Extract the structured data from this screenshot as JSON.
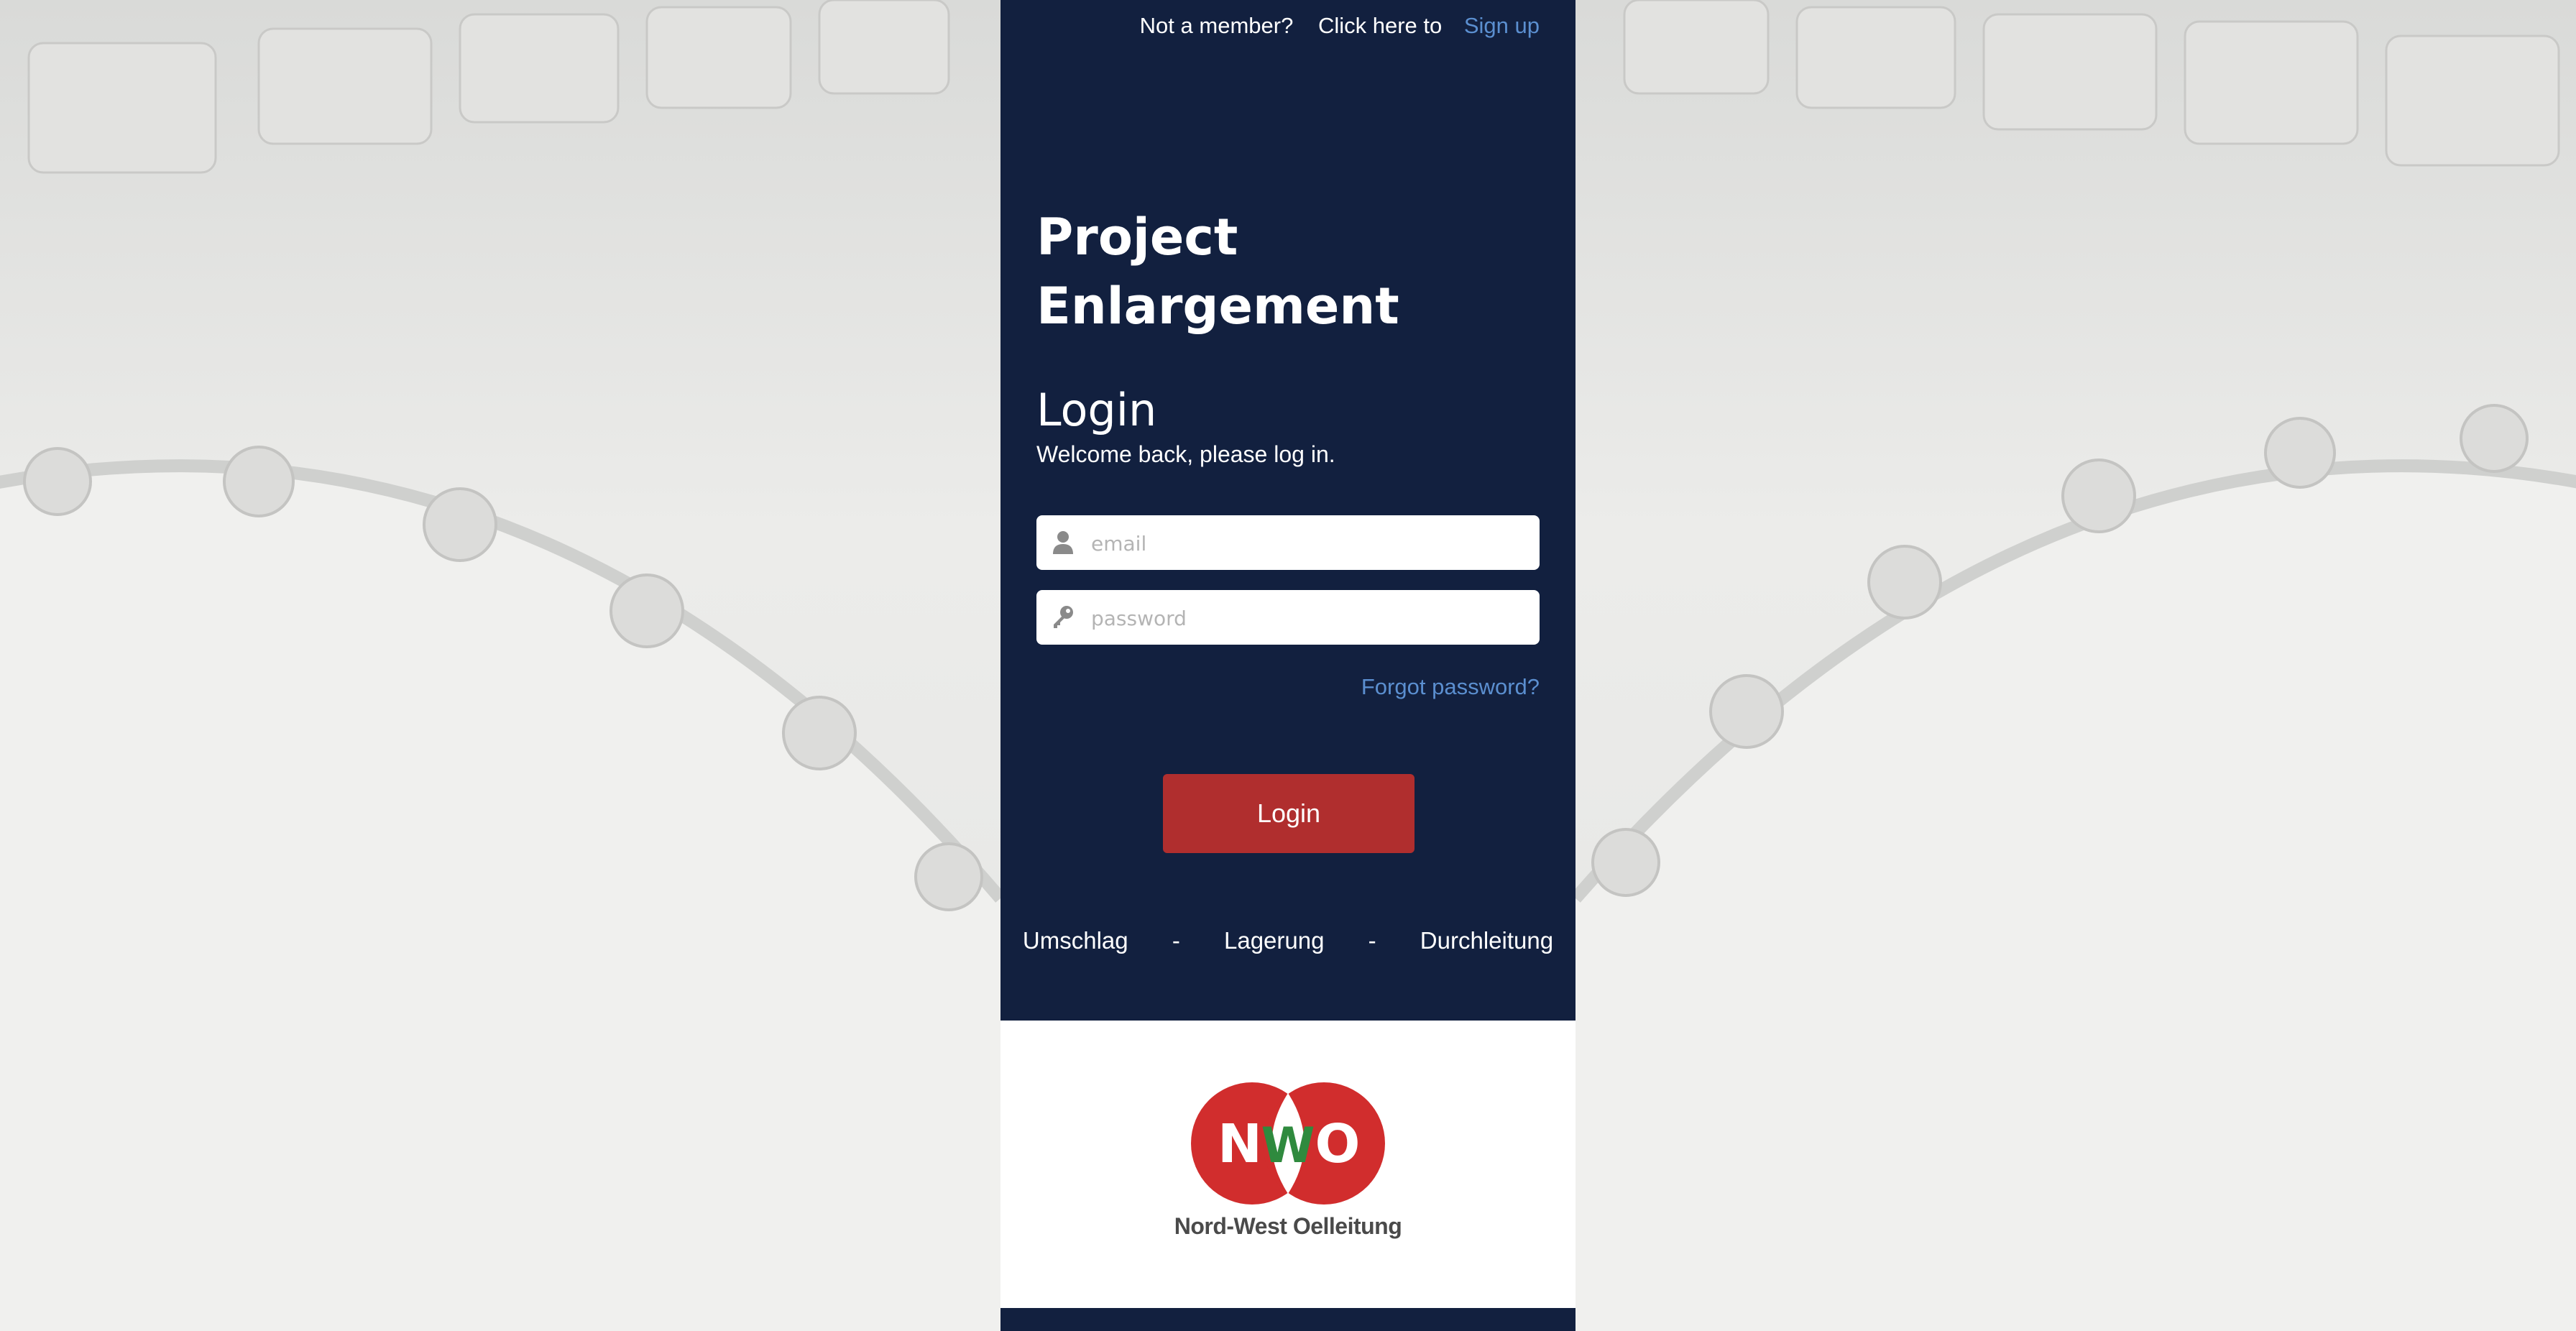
{
  "topbar": {
    "not_member": "Not a member?",
    "click_here": "Click here to",
    "signup": "Sign up"
  },
  "project_title": "Project Enlargement",
  "login": {
    "heading": "Login",
    "welcome": "Welcome back, please log in.",
    "email_placeholder": "email",
    "password_placeholder": "password",
    "forgot": "Forgot password?",
    "button": "Login"
  },
  "services": [
    "Umschlag",
    "-",
    "Lagerung",
    "-",
    "Durchleitung"
  ],
  "logo": {
    "letters": [
      "N",
      "W",
      "O"
    ],
    "company": "Nord-West Oelleitung"
  },
  "icons": {
    "email": "user-icon",
    "password": "key-icon"
  },
  "colors": {
    "panel": "#12203f",
    "accent_link": "#5b8fd0",
    "login_button": "#b02e2e",
    "logo_red": "#d12d2d",
    "logo_green": "#2f8a3e"
  }
}
